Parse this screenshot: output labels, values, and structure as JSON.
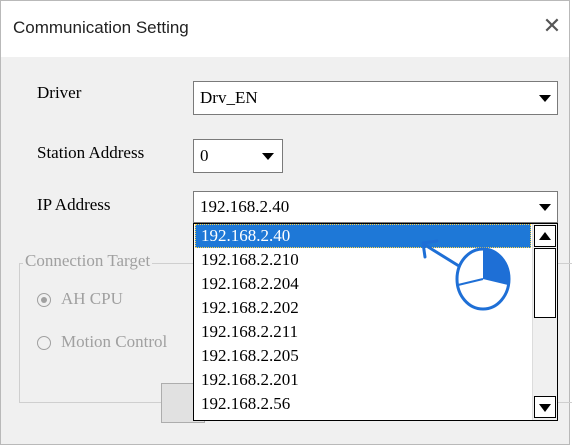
{
  "window": {
    "title": "Communication Setting",
    "close_glyph": "✕"
  },
  "form": {
    "driver_label": "Driver",
    "driver_value": "Drv_EN",
    "station_label": "Station Address",
    "station_value": "0",
    "ip_label": "IP Address",
    "ip_value": "192.168.2.40"
  },
  "connection_group": {
    "label": "Connection Target",
    "options": [
      {
        "label": "AH CPU",
        "selected": true
      },
      {
        "label": "Motion Control",
        "selected": false
      }
    ]
  },
  "ip_dropdown": {
    "options": [
      "192.168.2.40",
      "192.168.2.210",
      "192.168.2.204",
      "192.168.2.202",
      "192.168.2.211",
      "192.168.2.205",
      "192.168.2.201",
      "192.168.2.56"
    ],
    "selected_index": 0
  },
  "colors": {
    "selection": "#1e78d7",
    "annotation": "#1e6fd6",
    "disabled_text": "#a0a0a0"
  },
  "icons": {
    "annotation": "click-pointer-icon",
    "arrow": "arrow-icon"
  }
}
